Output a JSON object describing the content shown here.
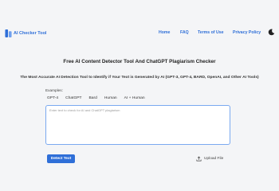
{
  "header": {
    "logo_text": "AI Checker Tool",
    "nav": [
      "Home",
      "FAQ",
      "Terms of Use",
      "Privacy Policy"
    ],
    "theme_icon": "moon-icon"
  },
  "hero": {
    "title": "Free AI Content Detector Tool And ChatGPT Plagiarism Checker",
    "subtitle": "The Most Accurate AI Detection Tool to Identify if Your Text is Generated by AI (GPT-3, GPT-4, BARD, OpenAI, and Other AI Tools)"
  },
  "examples": {
    "label": "Examples:",
    "chips": [
      "GPT-4",
      "ChatGPT",
      "Bard",
      "Human",
      "AI + Human"
    ]
  },
  "input": {
    "placeholder": "Enter text to check for AI and ChatGPT plagiarism"
  },
  "actions": {
    "detect_label": "Detect Text",
    "upload_label": "Upload File",
    "upload_icon": "upload-icon"
  },
  "colors": {
    "accent": "#2f6fd8",
    "background": "#f4f5f7"
  }
}
